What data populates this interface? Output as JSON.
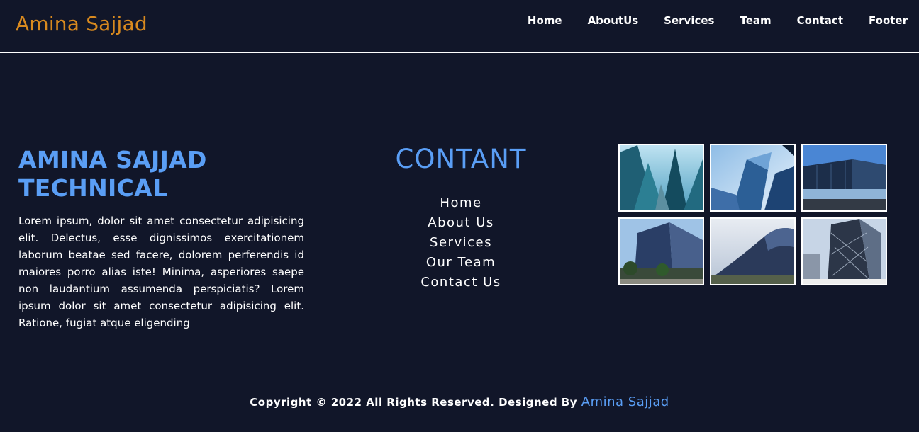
{
  "header": {
    "brand": "Amina Sajjad",
    "nav": [
      "Home",
      "AboutUs",
      "Services",
      "Team",
      "Contact",
      "Footer"
    ]
  },
  "about": {
    "title_line1": "AMINA SAJJAD",
    "title_line2": "TECHNICAL",
    "body": "Lorem ipsum, dolor sit amet consectetur adipisicing elit. Delectus, esse dignissimos exercitationem laborum beatae sed facere, dolorem perferendis id maiores porro alias iste! Minima, asperiores saepe non laudantium assumenda perspiciatis? Lorem ipsum dolor sit amet consectetur adipisicing elit. Ratione, fugiat atque eligending"
  },
  "content": {
    "heading": "CONTANT",
    "links": [
      "Home",
      "About Us",
      "Services",
      "Our Team",
      "Contact Us"
    ]
  },
  "gallery": {
    "images": [
      "skyscrapers-photo",
      "glass-tower-photo",
      "modern-building-photo",
      "office-block-photo",
      "curved-building-photo",
      "lattice-tower-photo"
    ]
  },
  "footer": {
    "copyright_prefix": "Copyright",
    "symbol": "©",
    "text": "2022 All Rights Reserved. Designed By",
    "designer": "Amina Sajjad"
  },
  "colors": {
    "background": "#111629",
    "brand": "#d98a1f",
    "accent": "#5a9ef5"
  }
}
